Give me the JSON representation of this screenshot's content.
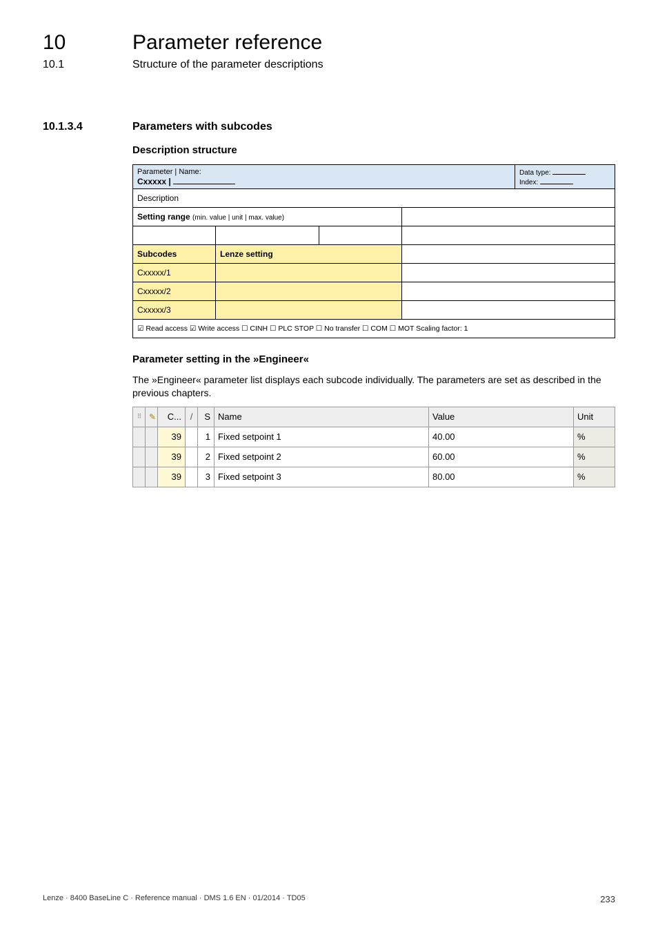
{
  "header": {
    "chapter_num": "10",
    "chapter_title": "Parameter reference",
    "section_num": "10.1",
    "section_title": "Structure of the parameter descriptions"
  },
  "dashes": "_ _ _ _ _ _ _ _ _ _ _ _ _ _ _ _ _ _ _ _ _ _ _ _ _ _ _ _ _ _ _ _ _ _ _ _ _ _ _ _ _ _ _ _ _ _ _ _ _ _ _ _ _ _ _ _ _ _ _ _ _ _ _ _",
  "subsection": {
    "num": "10.1.3.4",
    "title": "Parameters with subcodes"
  },
  "desc_structure_heading": "Description structure",
  "param_table": {
    "name_label": "Parameter | Name:",
    "name_value": "Cxxxxx |",
    "datatype_label": "Data type:",
    "index_label": "Index:",
    "description_row": "Description",
    "setting_range_label": "Setting range",
    "setting_range_small": "(min. value | unit | max. value)",
    "subcodes_header": "Subcodes",
    "lenze_header": "Lenze setting",
    "subcodes": [
      "Cxxxxx/1",
      "Cxxxxx/2",
      "Cxxxxx/3"
    ],
    "footer": "☑ Read access   ☑ Write access   ☐ CINH   ☐ PLC STOP   ☐ No transfer   ☐ COM   ☐ MOT    Scaling factor: 1"
  },
  "engineer": {
    "heading": "Parameter setting in the »Engineer«",
    "text": "The »Engineer« parameter list displays each subcode individually. The parameters are set as described in the previous chapters.",
    "headers": {
      "code": "C...",
      "slash": "/",
      "sub": "S",
      "name": "Name",
      "value": "Value",
      "unit": "Unit"
    },
    "rows": [
      {
        "code": "39",
        "sub": "1",
        "name": "Fixed setpoint 1",
        "value": "40.00",
        "unit": "%"
      },
      {
        "code": "39",
        "sub": "2",
        "name": "Fixed setpoint 2",
        "value": "60.00",
        "unit": "%"
      },
      {
        "code": "39",
        "sub": "3",
        "name": "Fixed setpoint 3",
        "value": "80.00",
        "unit": "%"
      }
    ]
  },
  "footer": {
    "left": "Lenze · 8400 BaseLine C · Reference manual · DMS 1.6 EN · 01/2014 · TD05",
    "page": "233"
  }
}
